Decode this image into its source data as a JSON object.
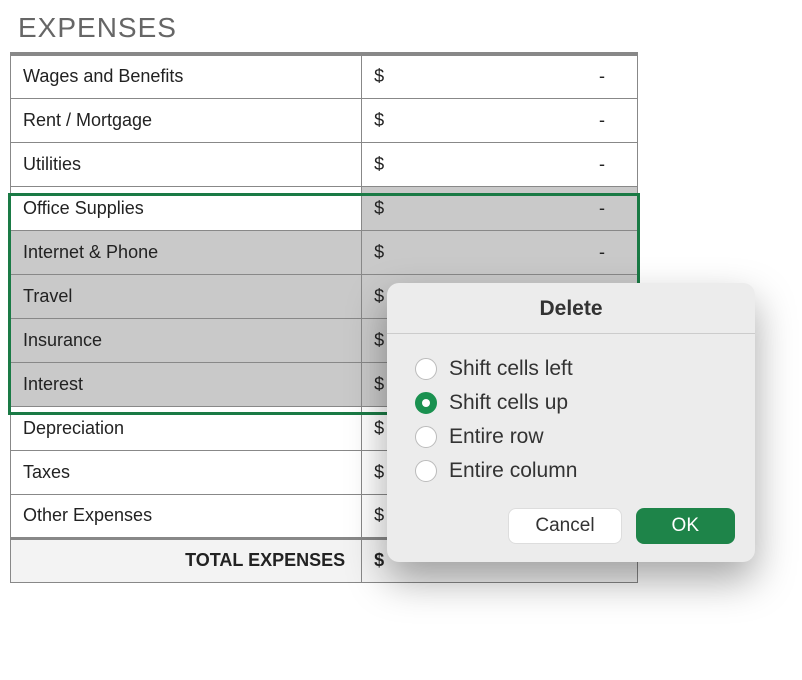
{
  "heading": "EXPENSES",
  "rows": [
    {
      "label": "Wages and Benefits",
      "currency": "$",
      "value": "-"
    },
    {
      "label": "Rent / Mortgage",
      "currency": "$",
      "value": "-"
    },
    {
      "label": "Utilities",
      "currency": "$",
      "value": "-"
    },
    {
      "label": "Office Supplies",
      "currency": "$",
      "value": "-"
    },
    {
      "label": "Internet & Phone",
      "currency": "$",
      "value": "-"
    },
    {
      "label": "Travel",
      "currency": "$",
      "value": ""
    },
    {
      "label": "Insurance",
      "currency": "$",
      "value": ""
    },
    {
      "label": "Interest",
      "currency": "$",
      "value": ""
    },
    {
      "label": "Depreciation",
      "currency": "$",
      "value": ""
    },
    {
      "label": "Taxes",
      "currency": "$",
      "value": ""
    },
    {
      "label": "Other Expenses",
      "currency": "$",
      "value": ""
    }
  ],
  "total": {
    "label": "TOTAL EXPENSES",
    "currency": "$",
    "value": ""
  },
  "dialog": {
    "title": "Delete",
    "options": {
      "shift_left": "Shift cells left",
      "shift_up": "Shift cells up",
      "entire_row": "Entire row",
      "entire_col": "Entire column"
    },
    "selected": "shift_up",
    "cancel": "Cancel",
    "ok": "OK"
  }
}
